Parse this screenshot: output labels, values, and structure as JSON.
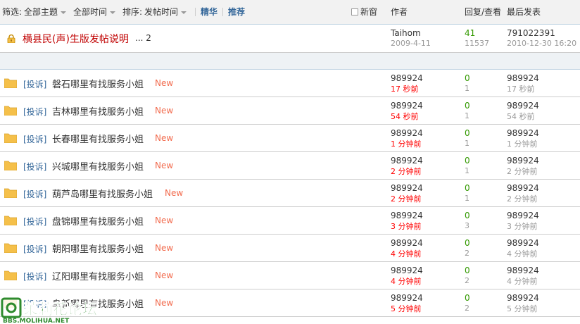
{
  "header": {
    "filter_label": "筛选:",
    "filter_value": "全部主题",
    "time_value": "全部时间",
    "sort_label": "排序:",
    "sort_value": "发帖时间",
    "digest": "精华",
    "recommend": "推荐",
    "new_window": "新窗",
    "author": "作者",
    "replies": "回复/查看",
    "last_post": "最后发表"
  },
  "sticky": {
    "title": "横县民(声)生版发帖说明",
    "pages": "... 2",
    "author": "Taihom",
    "date": "2009-4-11",
    "replies": "41",
    "views": "11537",
    "last_user": "791022391",
    "last_time": "2010-12-30 16:20"
  },
  "threads": [
    {
      "tag": "[投诉]",
      "title": "磐石哪里有找服务小姐",
      "new": "New",
      "author": "989924",
      "time": "17 秒前",
      "replies": "0",
      "views": "1",
      "last_user": "989924",
      "last_time": "17 秒前"
    },
    {
      "tag": "[投诉]",
      "title": "吉林哪里有找服务小姐",
      "new": "New",
      "author": "989924",
      "time": "54 秒前",
      "replies": "0",
      "views": "1",
      "last_user": "989924",
      "last_time": "54 秒前"
    },
    {
      "tag": "[投诉]",
      "title": "长春哪里有找服务小姐",
      "new": "New",
      "author": "989924",
      "time": "1 分钟前",
      "replies": "0",
      "views": "1",
      "last_user": "989924",
      "last_time": "1 分钟前"
    },
    {
      "tag": "[投诉]",
      "title": "兴城哪里有找服务小姐",
      "new": "New",
      "author": "989924",
      "time": "2 分钟前",
      "replies": "0",
      "views": "1",
      "last_user": "989924",
      "last_time": "2 分钟前"
    },
    {
      "tag": "[投诉]",
      "title": "葫芦岛哪里有找服务小姐",
      "new": "New",
      "author": "989924",
      "time": "2 分钟前",
      "replies": "0",
      "views": "1",
      "last_user": "989924",
      "last_time": "2 分钟前"
    },
    {
      "tag": "[投诉]",
      "title": "盘锦哪里有找服务小姐",
      "new": "New",
      "author": "989924",
      "time": "3 分钟前",
      "replies": "0",
      "views": "3",
      "last_user": "989924",
      "last_time": "3 分钟前"
    },
    {
      "tag": "[投诉]",
      "title": "朝阳哪里有找服务小姐",
      "new": "New",
      "author": "989924",
      "time": "4 分钟前",
      "replies": "0",
      "views": "2",
      "last_user": "989924",
      "last_time": "4 分钟前"
    },
    {
      "tag": "[投诉]",
      "title": "辽阳哪里有找服务小姐",
      "new": "New",
      "author": "989924",
      "time": "4 分钟前",
      "replies": "0",
      "views": "2",
      "last_user": "989924",
      "last_time": "4 分钟前"
    },
    {
      "tag": "[投诉]",
      "title": "阜新哪里有找服务小姐",
      "new": "New",
      "author": "989924",
      "time": "5 分钟前",
      "replies": "0",
      "views": "2",
      "last_user": "989924",
      "last_time": "5 分钟前"
    }
  ],
  "watermark": {
    "line1": "茉莉花论坛",
    "line2": "BBS.MOLIHUA.NET"
  },
  "colors": {
    "header_bg": "#f2f2f2",
    "sticky_title": "#c00000",
    "tag": "#336699",
    "new": "#f26c4f",
    "green_count": "#339900",
    "red_time": "#ff0000",
    "folder": "#f5c04a",
    "watermark": "#2e8b2e"
  }
}
